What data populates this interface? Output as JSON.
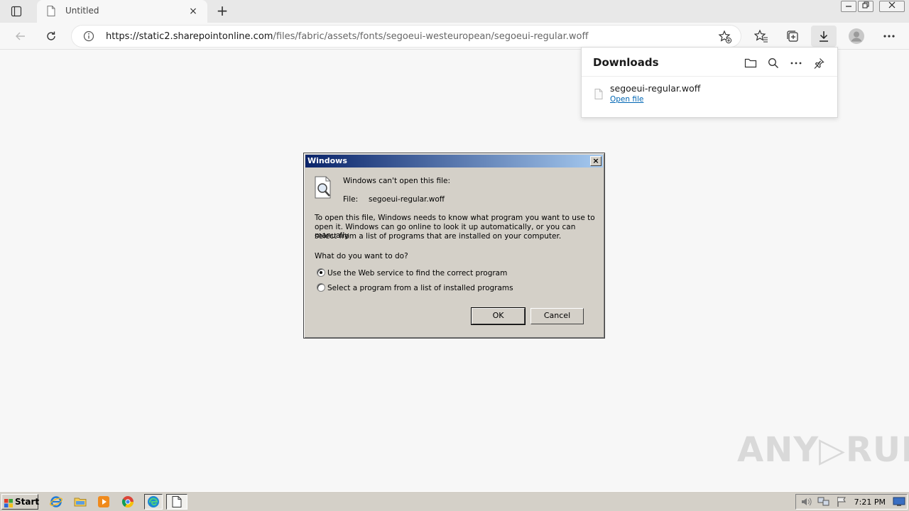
{
  "browser": {
    "tab_title": "Untitled",
    "new_tab": "+",
    "close_tab": "×",
    "url_host": "https://static2.sharepointonline.com",
    "url_path": "/files/fabric/assets/fonts/segoeui-westeuropean/segoeui-regular.woff"
  },
  "downloads": {
    "header": "Downloads",
    "file_name": "segoeui-regular.woff",
    "open_link": "Open file"
  },
  "dialog": {
    "title": "Windows",
    "close": "×",
    "cant_open": "Windows can't open this file:",
    "file_label": "File:",
    "file_name": "segoeui-regular.woff",
    "explain_1": "To open this file, Windows needs to know what program you want to use to",
    "explain_2": "open it. Windows can go online to look it up automatically, or you can manually",
    "explain_3": "select from a list of programs that are installed on your computer.",
    "question": "What do you want to do?",
    "option_web": "Use the Web service to find the correct program",
    "option_list": "Select a program from a list of installed programs",
    "selected_option": "web",
    "ok": "OK",
    "cancel": "Cancel"
  },
  "watermark": "ANY▷RUN",
  "taskbar": {
    "start": "Start",
    "time": "7:21 PM"
  },
  "icons": [
    "tab-actions-icon",
    "page-icon",
    "back-icon",
    "refresh-icon",
    "info-icon",
    "add-favorite-icon",
    "favorites-icon",
    "collections-icon",
    "download-icon",
    "profile-icon",
    "more-icon",
    "folder-icon",
    "search-icon",
    "pin-icon",
    "file-icon",
    "document-search-icon",
    "windows-flag-icon",
    "ie-icon",
    "explorer-icon",
    "media-player-icon",
    "chrome-icon",
    "edge-icon",
    "volume-icon",
    "network-icon",
    "action-center-flag-icon",
    "monitor-icon"
  ]
}
